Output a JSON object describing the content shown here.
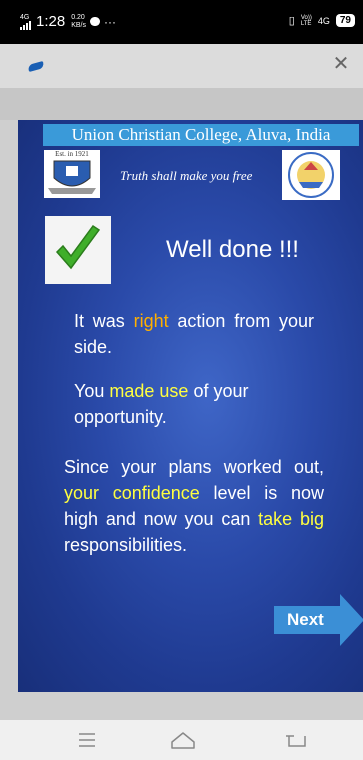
{
  "status_bar": {
    "network": "4G",
    "time": "1:28",
    "speed_value": "0.20",
    "speed_unit": "KB/s",
    "volte_label": "Vo))",
    "lte_label": "LTE",
    "network_right": "4G",
    "battery": "79"
  },
  "slide": {
    "banner": "Union Christian College, Aluva, India",
    "crest_left_text": "Est. in 1921",
    "motto": "Truth shall make you free",
    "heading": "Well done !!!",
    "p1": {
      "pre": "It was ",
      "hl": "right",
      "post": " action from your side."
    },
    "p2": {
      "pre": "You ",
      "hl": "made use",
      "post": " of your opportunity."
    },
    "p3": {
      "a": "Since your plans worked out, ",
      "hl1": "your confidence",
      "b": " level is now high and now you can ",
      "hl2": "take big",
      "c": " responsibilities."
    },
    "next_label": "Next"
  },
  "colors": {
    "accent_orange": "#ffb000",
    "accent_yellow": "#ffff40",
    "next_arrow": "#3b8fd6"
  }
}
